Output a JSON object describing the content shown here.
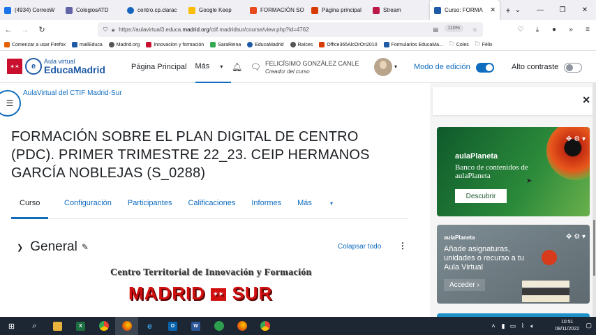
{
  "browser": {
    "tabs": [
      {
        "label": "(4934) CorreoW",
        "icon": "mail-icon",
        "color": "#1a73e8"
      },
      {
        "label": "ColegiosATD",
        "icon": "teams-icon",
        "color": "#6264a7"
      },
      {
        "label": "centro.cp.clarac",
        "icon": "globe-icon",
        "color": "#1565c0"
      },
      {
        "label": "Google Keep",
        "icon": "keep-icon",
        "color": "#fbbc04"
      },
      {
        "label": "FORMACIÓN SO",
        "icon": "moodle-icon",
        "color": "#e8491d"
      },
      {
        "label": "Página principal",
        "icon": "office-icon",
        "color": "#d83b01"
      },
      {
        "label": "Stream",
        "icon": "stream-icon",
        "color": "#bc1948"
      },
      {
        "label": "Curso: FORMA",
        "icon": "educamadrid-icon",
        "color": "#1f5aa6",
        "active": true
      }
    ],
    "new_tab": "+",
    "url_prefix": "https://aulavirtual3.educa.",
    "url_domain": "madrid.org",
    "url_suffix": "/ctif.madridsur/course/view.php?id=4762",
    "zoom": "110%",
    "bookmarks": [
      {
        "label": "Comenzar a usar Firefox",
        "color": "#e66000"
      },
      {
        "label": "mailEduca",
        "color": "#1f5aa6"
      },
      {
        "label": "Madrid.org",
        "color": "#555555"
      },
      {
        "label": "Innovacion y formación",
        "color": "#c8102e"
      },
      {
        "label": "SaraReina",
        "color": "#34a853"
      },
      {
        "label": "EducaMadrid",
        "color": "#1f5aa6"
      },
      {
        "label": "Raíces",
        "color": "#555555"
      },
      {
        "label": "Office365AlcOrOn2010",
        "color": "#d83b01"
      },
      {
        "label": "Formularios EducaMa...",
        "color": "#1f5aa6"
      },
      {
        "label": "Coles",
        "color": "#777777"
      },
      {
        "label": "Félix",
        "color": "#777777"
      }
    ]
  },
  "header": {
    "logo_line1": "Aula virtual",
    "logo_line2": "EducaMadrid",
    "nav_home": "Página Principal",
    "nav_more": "Más",
    "user_name": "FELICÍSIMO GONZÁLEZ CANLE",
    "user_role": "Creador del curso",
    "edit_mode": "Modo de edición",
    "high_contrast": "Alto contraste"
  },
  "course": {
    "breadcrumb": "AulaVirtual del CTIF Madrid-Sur",
    "title": "FORMACIÓN SOBRE EL PLAN DIGITAL DE CENTRO (PDC). PRIMER TRIMESTRE 22_23. CEIP HERMANOS GARCÍA NOBLEJAS (S_0288)",
    "tabs": [
      "Curso",
      "Configuración",
      "Participantes",
      "Calificaciones",
      "Informes",
      "Más"
    ],
    "section_name": "General",
    "collapse_all": "Colapsar todo",
    "banner_line1": "Centro Territorial de Innovación y Formación",
    "banner_line2": "MADRID",
    "banner_line3": "SUR"
  },
  "aside": {
    "card1_brand": "aulaPlaneta",
    "card1_desc": "Banco de contenidos de aulaPlaneta",
    "card1_button": "Descubrir",
    "card2_brand": "aulaPlaneta",
    "card2_desc": "Añade asignaturas, unidades o recurso a tu Aula Virtual",
    "card2_button": "Acceder"
  },
  "taskbar": {
    "time": "10:51",
    "date": "08/11/2022"
  }
}
